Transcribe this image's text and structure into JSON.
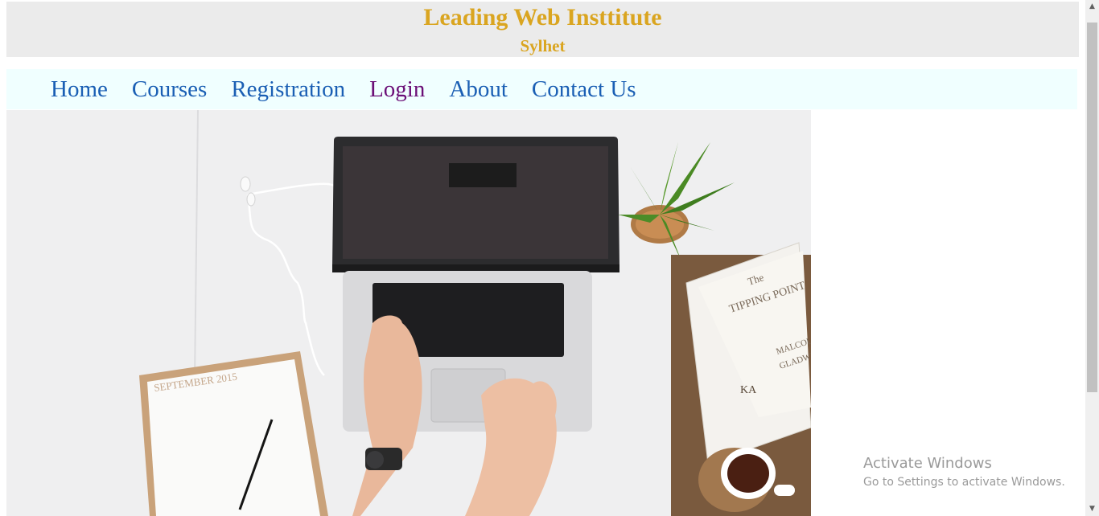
{
  "header": {
    "title": "Leading Web Insttitute",
    "subtitle": "Sylhet"
  },
  "nav": {
    "items": [
      {
        "label": "Home"
      },
      {
        "label": "Courses"
      },
      {
        "label": "Registration"
      },
      {
        "label": "Login"
      },
      {
        "label": "About"
      },
      {
        "label": "Contact Us"
      }
    ]
  },
  "hero": {
    "calendar_label": "SEPTEMBER 2015",
    "book_title_1": "The",
    "book_title_2": "TIPPING POINT",
    "book_author_1": "MALCOLM",
    "book_author_2": "GLADWELL",
    "book_spine_text": "KA"
  },
  "watermark": {
    "title": "Activate Windows",
    "subtitle": "Go to Settings to activate Windows."
  },
  "colors": {
    "title": "#daa520",
    "header_bg": "#ebebeb",
    "nav_bg": "#f0ffff",
    "link": "#1a5fb4",
    "visited_link": "#6b0f77"
  },
  "icons": {
    "scroll_up": "chevron-up-icon",
    "scroll_down": "chevron-down-icon"
  }
}
